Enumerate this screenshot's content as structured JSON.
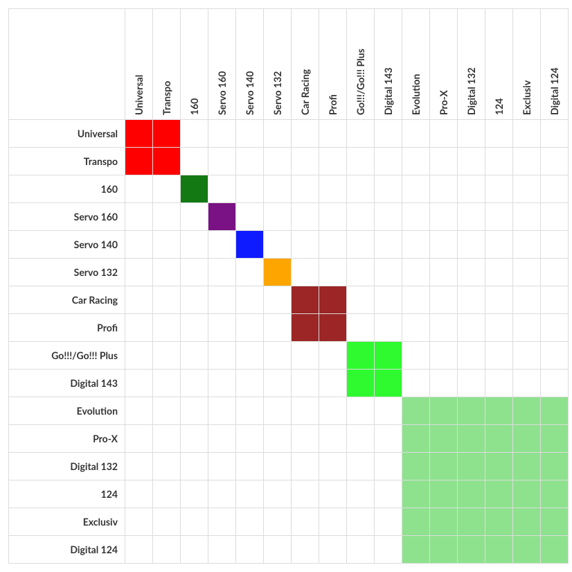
{
  "labels": [
    "Universal",
    "Transpo",
    "160",
    "Servo 160",
    "Servo 140",
    "Servo 132",
    "Car Racing",
    "Profi",
    "Go!!!/Go!!! Plus",
    "Digital 143",
    "Evolution",
    "Pro-X",
    "Digital 132",
    "124",
    "Exclusiv",
    "Digital 124"
  ],
  "palette": {
    "red": "#ff0000",
    "darkgreen": "#137913",
    "purple": "#7a1184",
    "blue": "#0f1bff",
    "orange": "#ffa500",
    "brown": "#9c2525",
    "lime": "#2ffa2f",
    "lightgreen": "#8ee28e"
  },
  "groups": [
    {
      "members": [
        0,
        1
      ],
      "color": "red"
    },
    {
      "members": [
        2
      ],
      "color": "darkgreen"
    },
    {
      "members": [
        3
      ],
      "color": "purple"
    },
    {
      "members": [
        4
      ],
      "color": "blue"
    },
    {
      "members": [
        5
      ],
      "color": "orange"
    },
    {
      "members": [
        6,
        7
      ],
      "color": "brown"
    },
    {
      "members": [
        8,
        9
      ],
      "color": "lime"
    },
    {
      "members": [
        10,
        11,
        12,
        13,
        14,
        15
      ],
      "color": "lightgreen"
    }
  ],
  "chart_data": {
    "type": "heatmap",
    "description": "Compatibility matrix: a cell is colored when the row system and column system belong to the same compatibility group; otherwise white.",
    "row_labels": [
      "Universal",
      "Transpo",
      "160",
      "Servo 160",
      "Servo 140",
      "Servo 132",
      "Car Racing",
      "Profi",
      "Go!!!/Go!!! Plus",
      "Digital 143",
      "Evolution",
      "Pro-X",
      "Digital 132",
      "124",
      "Exclusiv",
      "Digital 124"
    ],
    "col_labels": [
      "Universal",
      "Transpo",
      "160",
      "Servo 160",
      "Servo 140",
      "Servo 132",
      "Car Racing",
      "Profi",
      "Go!!!/Go!!! Plus",
      "Digital 143",
      "Evolution",
      "Pro-X",
      "Digital 132",
      "124",
      "Exclusiv",
      "Digital 124"
    ],
    "group_index": [
      0,
      0,
      1,
      2,
      3,
      4,
      5,
      5,
      6,
      6,
      7,
      7,
      7,
      7,
      7,
      7
    ],
    "group_colors": [
      "#ff0000",
      "#137913",
      "#7a1184",
      "#0f1bff",
      "#ffa500",
      "#9c2525",
      "#2ffa2f",
      "#8ee28e"
    ]
  }
}
